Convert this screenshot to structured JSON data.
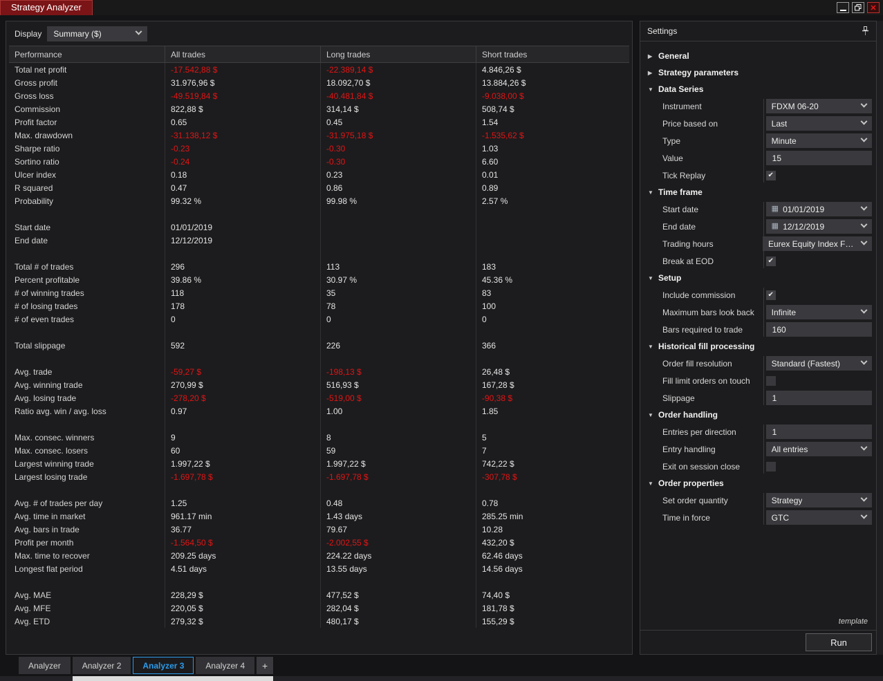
{
  "window": {
    "title": "Strategy Analyzer"
  },
  "display": {
    "label": "Display",
    "value": "Summary ($)"
  },
  "table": {
    "headers": [
      "Performance",
      "All trades",
      "Long trades",
      "Short trades"
    ],
    "rows": [
      [
        "Total net profit",
        "-17.542,88 $",
        "-22.389,14 $",
        "4.846,26 $"
      ],
      [
        "Gross profit",
        "31.976,96 $",
        "18.092,70 $",
        "13.884,26 $"
      ],
      [
        "Gross loss",
        "-49.519,84 $",
        "-40.481,84 $",
        "-9.038,00 $"
      ],
      [
        "Commission",
        "822,88 $",
        "314,14 $",
        "508,74 $"
      ],
      [
        "Profit factor",
        "0.65",
        "0.45",
        "1.54"
      ],
      [
        "Max. drawdown",
        "-31.138,12 $",
        "-31.975,18 $",
        "-1.535,62 $"
      ],
      [
        "Sharpe ratio",
        "-0.23",
        "-0.30",
        "1.03"
      ],
      [
        "Sortino ratio",
        "-0.24",
        "-0.30",
        "6.60"
      ],
      [
        "Ulcer index",
        "0.18",
        "0.23",
        "0.01"
      ],
      [
        "R squared",
        "0.47",
        "0.86",
        "0.89"
      ],
      [
        "Probability",
        "99.32 %",
        "99.98 %",
        "2.57 %"
      ],
      null,
      [
        "Start date",
        "01/01/2019",
        "",
        ""
      ],
      [
        "End date",
        "12/12/2019",
        "",
        ""
      ],
      null,
      [
        "Total # of trades",
        "296",
        "113",
        "183"
      ],
      [
        "Percent profitable",
        "39.86 %",
        "30.97 %",
        "45.36 %"
      ],
      [
        "# of winning trades",
        "118",
        "35",
        "83"
      ],
      [
        "# of losing trades",
        "178",
        "78",
        "100"
      ],
      [
        "# of even trades",
        "0",
        "0",
        "0"
      ],
      null,
      [
        "Total slippage",
        "592",
        "226",
        "366"
      ],
      null,
      [
        "Avg. trade",
        "-59,27 $",
        "-198,13 $",
        "26,48 $"
      ],
      [
        "Avg. winning trade",
        "270,99 $",
        "516,93 $",
        "167,28 $"
      ],
      [
        "Avg. losing trade",
        "-278,20 $",
        "-519,00 $",
        "-90,38 $"
      ],
      [
        "Ratio avg. win / avg. loss",
        "0.97",
        "1.00",
        "1.85"
      ],
      null,
      [
        "Max. consec. winners",
        "9",
        "8",
        "5"
      ],
      [
        "Max. consec. losers",
        "60",
        "59",
        "7"
      ],
      [
        "Largest winning trade",
        "1.997,22 $",
        "1.997,22 $",
        "742,22 $"
      ],
      [
        "Largest losing trade",
        "-1.697,78 $",
        "-1.697,78 $",
        "-307,78 $"
      ],
      null,
      [
        "Avg. # of trades per day",
        "1.25",
        "0.48",
        "0.78"
      ],
      [
        "Avg. time in market",
        "961.17 min",
        "1.43 days",
        "285.25 min"
      ],
      [
        "Avg. bars in trade",
        "36.77",
        "79.67",
        "10.28"
      ],
      [
        "Profit per month",
        "-1.564,50 $",
        "-2.002,55 $",
        "432,20 $"
      ],
      [
        "Max. time to recover",
        "209.25 days",
        "224.22 days",
        "62.46 days"
      ],
      [
        "Longest flat period",
        "4.51 days",
        "13.55 days",
        "14.56 days"
      ],
      null,
      [
        "Avg. MAE",
        "228,29 $",
        "477,52 $",
        "74,40 $"
      ],
      [
        "Avg. MFE",
        "220,05 $",
        "282,04 $",
        "181,78 $"
      ],
      [
        "Avg. ETD",
        "279,32 $",
        "480,17 $",
        "155,29 $"
      ]
    ]
  },
  "settings": {
    "title": "Settings",
    "template_label": "template",
    "run_label": "Run",
    "sections": [
      {
        "label": "General",
        "expanded": false,
        "items": []
      },
      {
        "label": "Strategy parameters",
        "expanded": false,
        "items": []
      },
      {
        "label": "Data Series",
        "expanded": true,
        "items": [
          {
            "label": "Instrument",
            "type": "dropdown",
            "value": "FDXM 06-20"
          },
          {
            "label": "Price based on",
            "type": "dropdown",
            "value": "Last"
          },
          {
            "label": "Type",
            "type": "dropdown",
            "value": "Minute"
          },
          {
            "label": "Value",
            "type": "input",
            "value": "15"
          },
          {
            "label": "Tick Replay",
            "type": "checkbox",
            "checked": true
          }
        ]
      },
      {
        "label": "Time frame",
        "expanded": true,
        "items": [
          {
            "label": "Start date",
            "type": "date",
            "value": "01/01/2019"
          },
          {
            "label": "End date",
            "type": "date",
            "value": "12/12/2019"
          },
          {
            "label": "Trading hours",
            "type": "dropdown",
            "value": "Eurex Equity Index Fut..."
          },
          {
            "label": "Break at EOD",
            "type": "checkbox",
            "checked": true
          }
        ]
      },
      {
        "label": "Setup",
        "expanded": true,
        "items": [
          {
            "label": "Include commission",
            "type": "checkbox",
            "checked": true
          },
          {
            "label": "Maximum bars look back",
            "type": "dropdown",
            "value": "Infinite"
          },
          {
            "label": "Bars required to trade",
            "type": "input",
            "value": "160"
          }
        ]
      },
      {
        "label": "Historical fill processing",
        "expanded": true,
        "items": [
          {
            "label": "Order fill resolution",
            "type": "dropdown",
            "value": "Standard (Fastest)"
          },
          {
            "label": "Fill limit orders on touch",
            "type": "checkbox",
            "checked": false
          },
          {
            "label": "Slippage",
            "type": "input",
            "value": "1"
          }
        ]
      },
      {
        "label": "Order handling",
        "expanded": true,
        "items": [
          {
            "label": "Entries per direction",
            "type": "input",
            "value": "1"
          },
          {
            "label": "Entry handling",
            "type": "dropdown",
            "value": "All entries"
          },
          {
            "label": "Exit on session close",
            "type": "checkbox",
            "checked": false
          }
        ]
      },
      {
        "label": "Order properties",
        "expanded": true,
        "items": [
          {
            "label": "Set order quantity",
            "type": "dropdown",
            "value": "Strategy"
          },
          {
            "label": "Time in force",
            "type": "dropdown",
            "value": "GTC"
          }
        ]
      }
    ]
  },
  "tabs": {
    "items": [
      "Analyzer",
      "Analyzer 2",
      "Analyzer 3",
      "Analyzer 4"
    ],
    "active_index": 2,
    "add_label": "+"
  },
  "colors": {
    "negative_value": "#e21414",
    "active_tab": "#2d9ae8",
    "title_tab_bg": "#7a1416",
    "panel_bg": "#1c1c1e",
    "control_bg": "#3a3a3e"
  }
}
